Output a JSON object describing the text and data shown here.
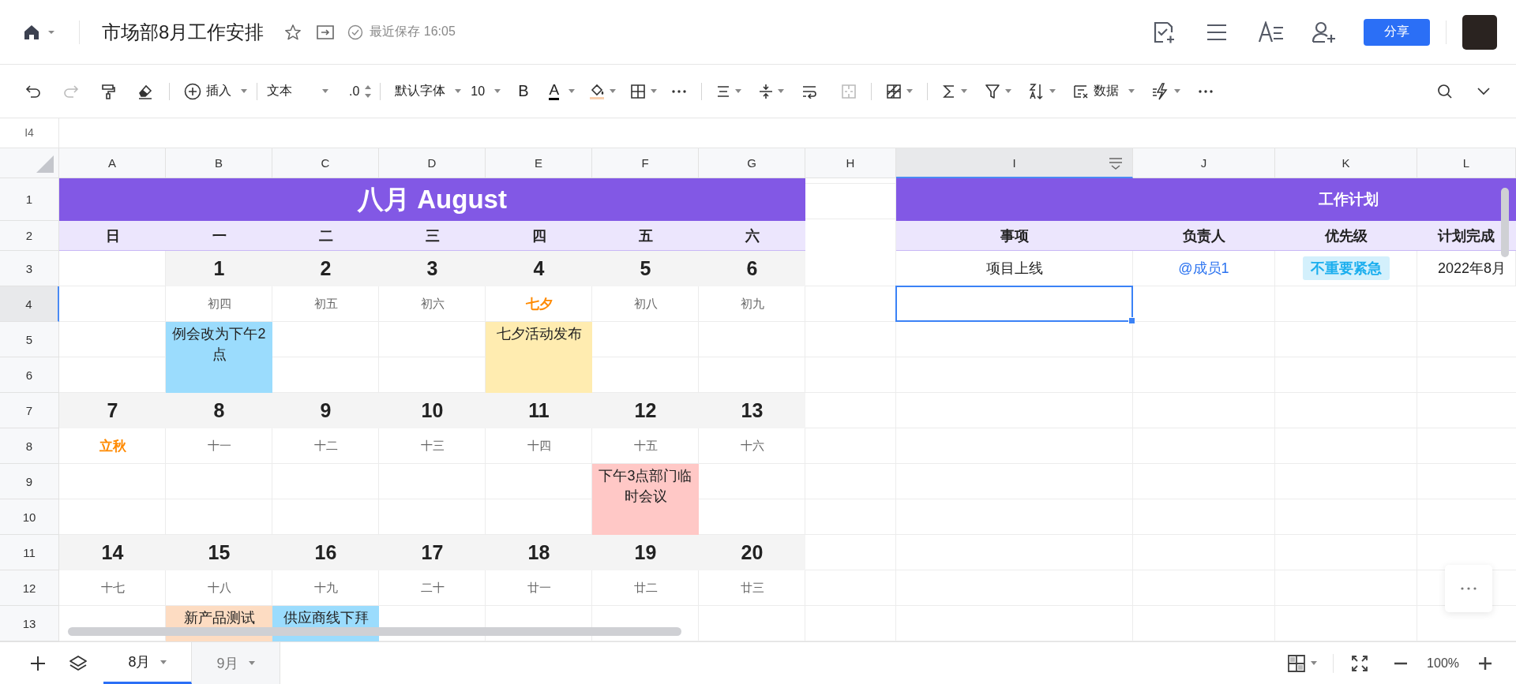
{
  "app_bar": {
    "title": "市场部8月工作安排",
    "save_status": "最近保存 16:05",
    "share_button": "分享"
  },
  "toolbar": {
    "insert": "插入",
    "format": "文本",
    "decimal": ".0",
    "font": "默认字体",
    "font_size": "10",
    "bold": "B",
    "font_color": "A",
    "data": "数据"
  },
  "cell_ref": "I4",
  "sheet": {
    "columns": [
      {
        "label": "A",
        "selected": false
      },
      {
        "label": "B",
        "selected": false
      },
      {
        "label": "C",
        "selected": false
      },
      {
        "label": "D",
        "selected": false
      },
      {
        "label": "E",
        "selected": false
      },
      {
        "label": "F",
        "selected": false
      },
      {
        "label": "G",
        "selected": false
      },
      {
        "label": "H",
        "selected": false
      },
      {
        "label": "I",
        "selected": true
      },
      {
        "label": "J",
        "selected": false
      },
      {
        "label": "K",
        "selected": false
      },
      {
        "label": "L",
        "selected": false
      }
    ],
    "rows": [
      {
        "label": "1",
        "selected": false
      },
      {
        "label": "2",
        "selected": false
      },
      {
        "label": "3",
        "selected": false
      },
      {
        "label": "4",
        "selected": true
      },
      {
        "label": "5",
        "selected": false
      },
      {
        "label": "6",
        "selected": false
      },
      {
        "label": "7",
        "selected": false
      },
      {
        "label": "8",
        "selected": false
      },
      {
        "label": "9",
        "selected": false
      },
      {
        "label": "10",
        "selected": false
      },
      {
        "label": "11",
        "selected": false
      },
      {
        "label": "12",
        "selected": false
      },
      {
        "label": "13",
        "selected": false
      }
    ]
  },
  "calendar": {
    "title": "八月 August",
    "weekdays": [
      "日",
      "一",
      "二",
      "三",
      "四",
      "五",
      "六"
    ],
    "weeks": [
      {
        "days": [
          {
            "date": "1",
            "lunar": "初四",
            "festival": false,
            "event": {
              "text": "例会改为下午2点",
              "color": "#9bdcfd"
            }
          },
          {
            "date": "2",
            "lunar": "初五",
            "festival": false
          },
          {
            "date": "3",
            "lunar": "初六",
            "festival": false
          },
          {
            "date": "4",
            "lunar": "七夕",
            "festival": true,
            "event": {
              "text": "七夕活动发布",
              "color": "#ffecb0"
            }
          },
          {
            "date": "5",
            "lunar": "初八",
            "festival": false
          },
          {
            "date": "6",
            "lunar": "初九",
            "festival": false
          }
        ]
      },
      {
        "days": [
          {
            "date": "7",
            "lunar": "立秋",
            "festival": true
          },
          {
            "date": "8",
            "lunar": "十一",
            "festival": false
          },
          {
            "date": "9",
            "lunar": "十二",
            "festival": false
          },
          {
            "date": "10",
            "lunar": "十三",
            "festival": false
          },
          {
            "date": "11",
            "lunar": "十四",
            "festival": false
          },
          {
            "date": "12",
            "lunar": "十五",
            "festival": false,
            "event": {
              "text": "下午3点部门临时会议",
              "color": "#ffc8c6"
            }
          },
          {
            "date": "13",
            "lunar": "十六",
            "festival": false
          }
        ]
      },
      {
        "days": [
          {
            "date": "14",
            "lunar": "十七",
            "festival": false
          },
          {
            "date": "15",
            "lunar": "十八",
            "festival": false,
            "event": {
              "text": "新产品测试",
              "color": "#fddcc2"
            }
          },
          {
            "date": "16",
            "lunar": "十九",
            "festival": false,
            "event": {
              "text": "供应商线下拜",
              "color": "#9bdcfd"
            }
          },
          {
            "date": "17",
            "lunar": "二十",
            "festival": false
          },
          {
            "date": "18",
            "lunar": "廿一",
            "festival": false
          },
          {
            "date": "19",
            "lunar": "廿二",
            "festival": false
          },
          {
            "date": "20",
            "lunar": "廿三",
            "festival": false
          }
        ]
      }
    ]
  },
  "plan": {
    "title": "工作计划",
    "headers": [
      "事项",
      "负责人",
      "优先级",
      "计划完成"
    ],
    "rows": [
      {
        "item": "项目上线",
        "owner": "@成员1",
        "priority": "不重要紧急",
        "due": "2022年8月"
      }
    ]
  },
  "sheet_tabs": [
    {
      "label": "8月",
      "selected": true
    },
    {
      "label": "9月",
      "selected": false
    }
  ],
  "zoom": "100%"
}
